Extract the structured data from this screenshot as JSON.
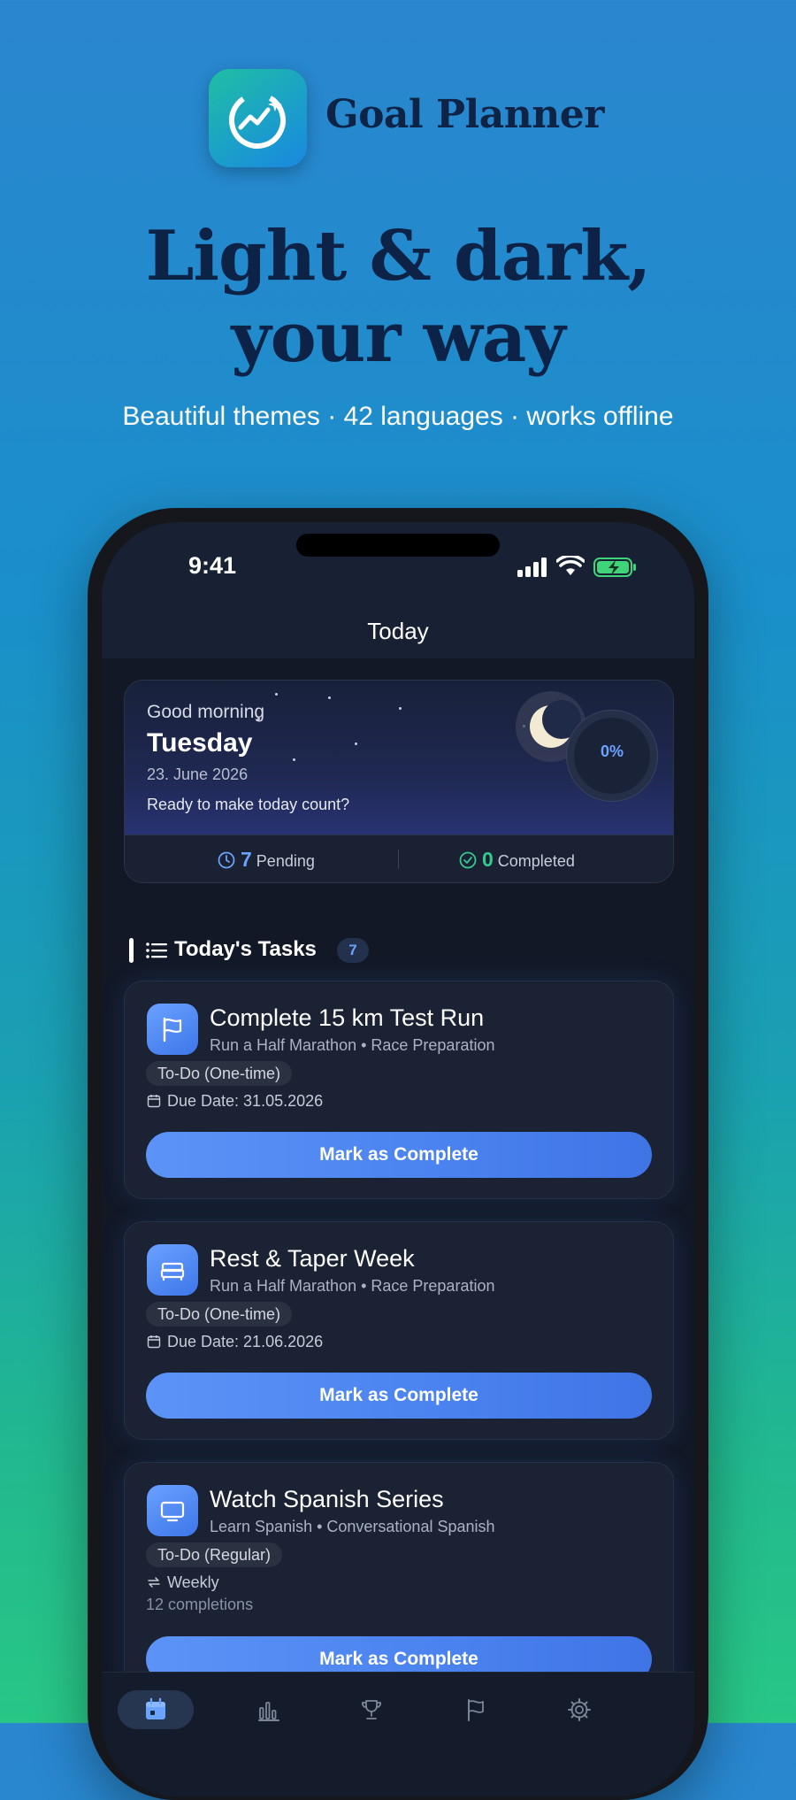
{
  "app": {
    "name": "Goal Planner",
    "icon": "goal-planner-logo-icon",
    "headline_line1": "Light & dark,",
    "headline_line2": "your way",
    "subline": "Beautiful themes · 42 languages · works offline"
  },
  "status_bar": {
    "time": "9:41",
    "icons": [
      "cellular-signal-icon",
      "wifi-icon",
      "battery-charging-icon"
    ]
  },
  "nav": {
    "title": "Today"
  },
  "greeting": {
    "hello": "Good morning",
    "day": "Tuesday",
    "date": "23. June 2026",
    "tagline": "Ready to make today count?",
    "progress": "0%",
    "pending_count": "7",
    "pending_label": "Pending",
    "completed_count": "0",
    "completed_label": "Completed",
    "colors": {
      "pending": "#6aa3ff",
      "completed": "#35c98e"
    }
  },
  "section": {
    "title": "Today's Tasks",
    "count": "7"
  },
  "tasks": [
    {
      "icon": "flag-icon",
      "title": "Complete 15 km Test Run",
      "subtitle": "Run a Half Marathon • Race Preparation",
      "type": "To-Do (One-time)",
      "meta": "Due Date: 31.05.2026",
      "button": "Mark as Complete"
    },
    {
      "icon": "bed-icon",
      "title": "Rest & Taper Week",
      "subtitle": "Run a Half Marathon • Race Preparation",
      "type": "To-Do (One-time)",
      "meta": "Due Date: 21.06.2026",
      "button": "Mark as Complete"
    },
    {
      "icon": "tv-icon",
      "title": "Watch Spanish Series",
      "subtitle": "Learn Spanish • Conversational Spanish",
      "type": "To-Do (Regular)",
      "meta": "Weekly",
      "meta2": "12 completions",
      "button": "Mark as Complete"
    }
  ],
  "tab_bar": {
    "items": [
      {
        "icon": "calendar-icon",
        "active": true
      },
      {
        "icon": "bar-chart-icon",
        "active": false
      },
      {
        "icon": "trophy-icon",
        "active": false
      },
      {
        "icon": "flag-icon",
        "active": false
      },
      {
        "icon": "gear-icon",
        "active": false
      }
    ]
  },
  "accent_color": "#4a82ef"
}
